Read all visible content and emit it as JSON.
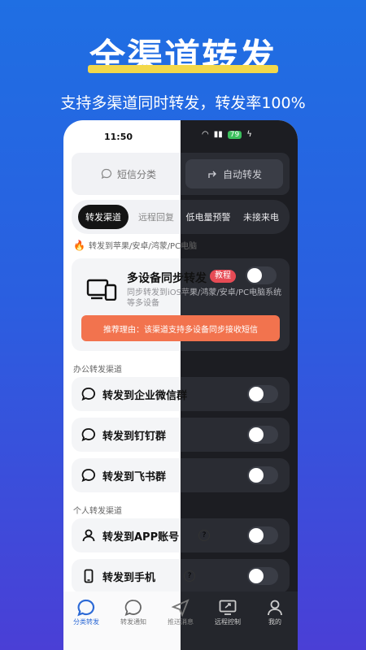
{
  "hero": {
    "title": "全渠道转发",
    "subtitle": "支持多渠道同时转发，转发率100%"
  },
  "status": {
    "time": "11:50",
    "battery": "79"
  },
  "segments": {
    "left": "短信分类",
    "right": "自动转发"
  },
  "tabs": [
    "转发渠道",
    "远程回复",
    "低电量预警",
    "未接来电"
  ],
  "sections": {
    "featured": "转发到苹果/安卓/鸿蒙/PC电脑",
    "office": "办公转发渠道",
    "personal": "个人转发渠道"
  },
  "featured_card": {
    "title": "多设备同步转发",
    "badge": "教程",
    "desc": "同步转发到iOS苹果/鸿蒙/安卓/PC电脑系统等多设备",
    "reason": "推荐理由：该渠道支持多设备同步接收短信"
  },
  "office_rows": [
    {
      "label": "转发到企业微信群"
    },
    {
      "label": "转发到钉钉群"
    },
    {
      "label": "转发到飞书群"
    }
  ],
  "personal_rows": [
    {
      "label": "转发到APP账号"
    },
    {
      "label": "转发到手机"
    }
  ],
  "nav": [
    "分类转发",
    "转发通知",
    "推送消息",
    "远程控制",
    "我的"
  ],
  "colors": {
    "accent": "#2d6ad6",
    "reason_bg": "#f2734e",
    "badge": "#e64b55",
    "hero_underline": "#f3d84a"
  }
}
